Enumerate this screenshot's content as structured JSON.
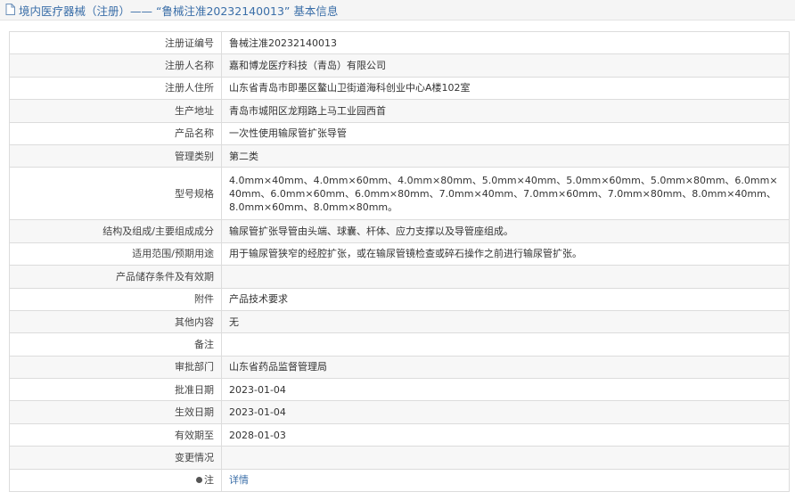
{
  "header": {
    "title": "境内医疗器械（注册）——  “鲁械注准20232140013”  基本信息"
  },
  "rows": [
    {
      "label": "注册证编号",
      "value": "鲁械注准20232140013"
    },
    {
      "label": "注册人名称",
      "value": "嘉和博龙医疗科技（青岛）有限公司"
    },
    {
      "label": "注册人住所",
      "value": "山东省青岛市即墨区鳌山卫街道海科创业中心A楼102室"
    },
    {
      "label": "生产地址",
      "value": "青岛市城阳区龙翔路上马工业园西首"
    },
    {
      "label": "产品名称",
      "value": "一次性使用输尿管扩张导管"
    },
    {
      "label": "管理类别",
      "value": "第二类"
    },
    {
      "label": "型号规格",
      "value": "4.0mm×40mm、4.0mm×60mm、4.0mm×80mm、5.0mm×40mm、5.0mm×60mm、5.0mm×80mm、6.0mm×40mm、6.0mm×60mm、6.0mm×80mm、7.0mm×40mm、7.0mm×60mm、7.0mm×80mm、8.0mm×40mm、8.0mm×60mm、8.0mm×80mm。"
    },
    {
      "label": "结构及组成/主要组成成分",
      "value": "输尿管扩张导管由头端、球囊、杆体、应力支撑以及导管座组成。"
    },
    {
      "label": "适用范围/预期用途",
      "value": "用于输尿管狭窄的经腔扩张，或在输尿管镜检查或碎石操作之前进行输尿管扩张。"
    },
    {
      "label": "产品储存条件及有效期",
      "value": ""
    },
    {
      "label": "附件",
      "value": "产品技术要求"
    },
    {
      "label": "其他内容",
      "value": "无"
    },
    {
      "label": "备注",
      "value": ""
    },
    {
      "label": "审批部门",
      "value": "山东省药品监督管理局"
    },
    {
      "label": "批准日期",
      "value": "2023-01-04"
    },
    {
      "label": "生效日期",
      "value": "2023-01-04"
    },
    {
      "label": "有效期至",
      "value": "2028-01-03"
    },
    {
      "label": "变更情况",
      "value": ""
    },
    {
      "label": "注",
      "value": "详情"
    }
  ],
  "colors": {
    "link": "#3a6ea8",
    "alt_row": "#f7f7f7",
    "border": "#dcdcdc"
  }
}
